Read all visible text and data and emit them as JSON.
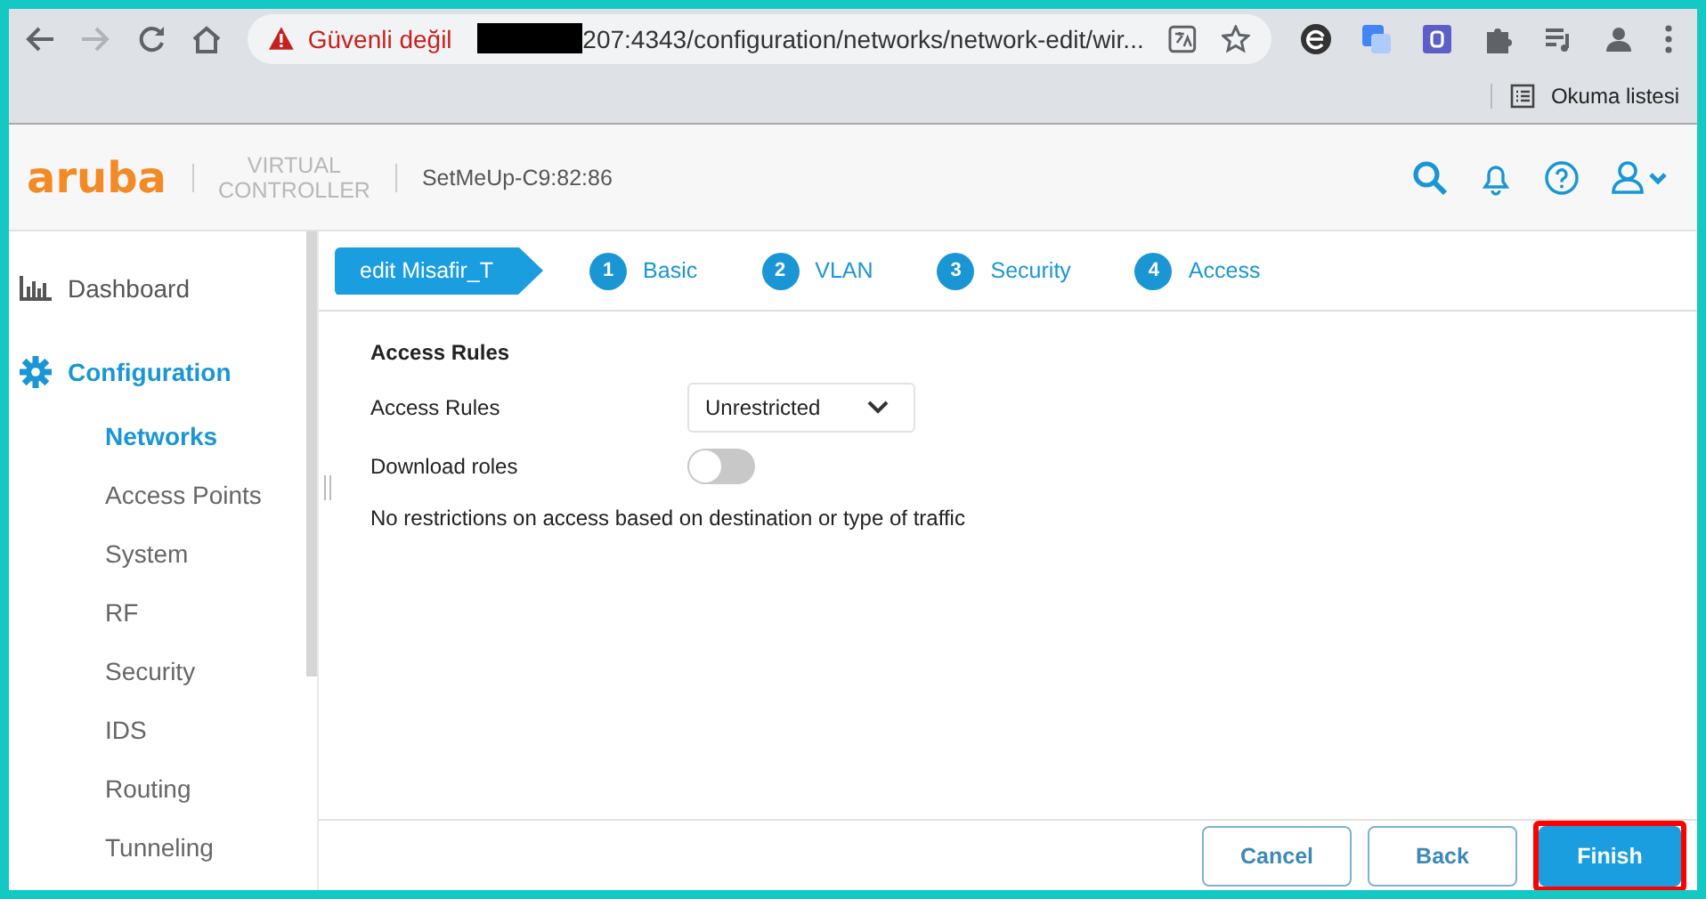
{
  "browser": {
    "security_label": "Güvenli değil",
    "url": "207:4343/configuration/networks/network-edit/wir...",
    "reading_list": "Okuma listesi"
  },
  "header": {
    "logo": "aruba",
    "product_line1": "VIRTUAL",
    "product_line2": "CONTROLLER",
    "device": "SetMeUp-C9:82:86"
  },
  "sidebar": {
    "items": [
      {
        "label": "Dashboard",
        "kind": "section",
        "selected": false
      },
      {
        "label": "Configuration",
        "kind": "section",
        "selected": true
      },
      {
        "label": "Networks",
        "kind": "sub",
        "selected": true
      },
      {
        "label": "Access Points",
        "kind": "sub",
        "selected": false
      },
      {
        "label": "System",
        "kind": "sub",
        "selected": false
      },
      {
        "label": "RF",
        "kind": "sub",
        "selected": false
      },
      {
        "label": "Security",
        "kind": "sub",
        "selected": false
      },
      {
        "label": "IDS",
        "kind": "sub",
        "selected": false
      },
      {
        "label": "Routing",
        "kind": "sub",
        "selected": false
      },
      {
        "label": "Tunneling",
        "kind": "sub",
        "selected": false
      }
    ]
  },
  "wizard": {
    "title": "edit Misafir_T",
    "steps": [
      {
        "number": "1",
        "label": "Basic"
      },
      {
        "number": "2",
        "label": "VLAN"
      },
      {
        "number": "3",
        "label": "Security"
      },
      {
        "number": "4",
        "label": "Access"
      }
    ]
  },
  "form": {
    "heading": "Access Rules",
    "fields": [
      {
        "kind": "select",
        "label": "Access Rules",
        "value": "Unrestricted"
      },
      {
        "kind": "toggle",
        "label": "Download roles",
        "on": false
      }
    ],
    "note": "No restrictions on access based on destination or type of traffic"
  },
  "footer": {
    "buttons": [
      {
        "label": "Cancel",
        "kind": "secondary",
        "highlighted": false
      },
      {
        "label": "Back",
        "kind": "secondary",
        "highlighted": false
      },
      {
        "label": "Finish",
        "kind": "primary",
        "highlighted": true
      }
    ]
  }
}
